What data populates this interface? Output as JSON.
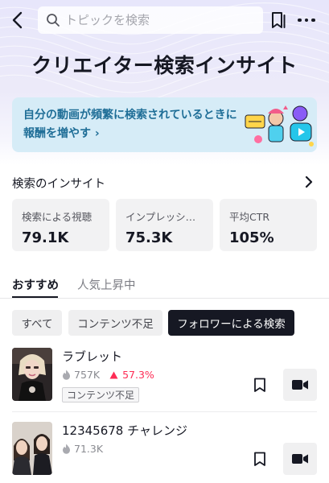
{
  "search": {
    "placeholder": "トピックを検索"
  },
  "page_title": "クリエイター検索インサイト",
  "banner": {
    "text": "自分の動画が頻繁に検索されているときに報酬を増やす",
    "chevron": "›"
  },
  "insights": {
    "title": "検索のインサイト",
    "stats": [
      {
        "label": "検索による視聴",
        "value": "79.1K"
      },
      {
        "label": "インプレッシ…",
        "value": "75.3K"
      },
      {
        "label": "平均CTR",
        "value": "105%"
      }
    ]
  },
  "tabs": [
    {
      "label": "おすすめ",
      "active": true
    },
    {
      "label": "人気上昇中",
      "active": false
    }
  ],
  "filters": [
    {
      "label": "すべて",
      "selected": false
    },
    {
      "label": "コンテンツ不足",
      "selected": false
    },
    {
      "label": "フォロワーによる検索",
      "selected": true
    }
  ],
  "topics": [
    {
      "title": "ラブレット",
      "views": "757K",
      "trend": "57.3%",
      "tag": "コンテンツ不足"
    },
    {
      "title": "12345678 チャレンジ",
      "views": "71.3K"
    }
  ],
  "colors": {
    "accent": "#fe2c55",
    "banner_text": "#1f6e97",
    "banner_bg": "#d6ecf7",
    "chip_selected": "#161823"
  },
  "icons": [
    "back-arrow-icon",
    "search-icon",
    "bookmark-icon",
    "more-icon",
    "chevron-right-icon",
    "flame-icon",
    "trend-up-icon",
    "video-camera-icon"
  ]
}
